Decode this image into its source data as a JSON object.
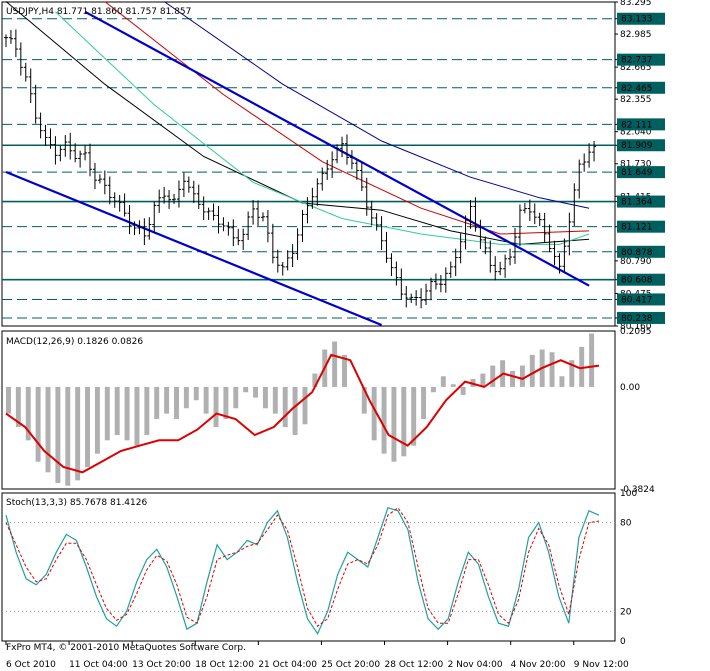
{
  "chart_data": {
    "type": "candlestick",
    "symbol_header": "USDJPY,H4  81.771 81.860 81.757 81.857",
    "watermark": "FxPro MT4, © 2001-2010 MetaQuotes Software Corp.",
    "x_ticks": [
      "6 Oct 2010",
      "11 Oct 04:00",
      "13 Oct 20:00",
      "18 Oct 12:00",
      "21 Oct 04:00",
      "25 Oct 20:00",
      "28 Oct 12:00",
      "2 Nov 04:00",
      "4 Nov 20:00",
      "9 Nov 12:00"
    ],
    "price_axis": {
      "ylim": [
        80.16,
        83.295
      ],
      "ticks": [
        "83.295",
        "83.133",
        "82.985",
        "82.737",
        "82.665",
        "82.465",
        "82.355",
        "82.111",
        "82.040",
        "81.909",
        "81.730",
        "81.649",
        "81.415",
        "81.364",
        "81.121",
        "80.790",
        "80.878",
        "80.608",
        "80.475",
        "80.417",
        "80.238",
        "80.160"
      ]
    },
    "close_path": [
      [
        0,
        82.95
      ],
      [
        2,
        82.85
      ],
      [
        4,
        82.55
      ],
      [
        6,
        82.2
      ],
      [
        8,
        81.95
      ],
      [
        10,
        81.85
      ],
      [
        12,
        81.9
      ],
      [
        14,
        81.82
      ],
      [
        16,
        81.8
      ],
      [
        18,
        81.6
      ],
      [
        20,
        81.5
      ],
      [
        22,
        81.38
      ],
      [
        24,
        81.25
      ],
      [
        26,
        81.1
      ],
      [
        28,
        81.05
      ],
      [
        30,
        81.3
      ],
      [
        32,
        81.45
      ],
      [
        34,
        81.35
      ],
      [
        36,
        81.6
      ],
      [
        38,
        81.4
      ],
      [
        40,
        81.3
      ],
      [
        42,
        81.2
      ],
      [
        44,
        81.15
      ],
      [
        46,
        81.0
      ],
      [
        48,
        81.05
      ],
      [
        50,
        81.3
      ],
      [
        52,
        81.2
      ],
      [
        54,
        80.85
      ],
      [
        56,
        80.7
      ],
      [
        58,
        80.9
      ],
      [
        60,
        81.2
      ],
      [
        62,
        81.45
      ],
      [
        64,
        81.6
      ],
      [
        66,
        81.8
      ],
      [
        68,
        81.9
      ],
      [
        70,
        81.75
      ],
      [
        72,
        81.5
      ],
      [
        74,
        81.2
      ],
      [
        76,
        81.0
      ],
      [
        78,
        80.7
      ],
      [
        80,
        80.5
      ],
      [
        82,
        80.4
      ],
      [
        84,
        80.45
      ],
      [
        86,
        80.55
      ],
      [
        88,
        80.6
      ],
      [
        90,
        80.7
      ],
      [
        92,
        81.0
      ],
      [
        94,
        81.3
      ],
      [
        96,
        81.0
      ],
      [
        98,
        80.75
      ],
      [
        100,
        80.7
      ],
      [
        102,
        80.85
      ],
      [
        104,
        81.25
      ],
      [
        106,
        81.3
      ],
      [
        108,
        81.15
      ],
      [
        110,
        80.95
      ],
      [
        112,
        80.7
      ],
      [
        114,
        81.2
      ],
      [
        116,
        81.7
      ],
      [
        118,
        81.86
      ]
    ],
    "horizontal_levels": [
      {
        "value": "83.133",
        "solid": false
      },
      {
        "value": "82.737",
        "solid": false
      },
      {
        "value": "82.465",
        "solid": false
      },
      {
        "value": "82.111",
        "solid": false
      },
      {
        "value": "81.909",
        "solid": true
      },
      {
        "value": "81.649",
        "solid": false
      },
      {
        "value": "81.364",
        "solid": true
      },
      {
        "value": "81.121",
        "solid": false
      },
      {
        "value": "80.878",
        "solid": false
      },
      {
        "value": "80.608",
        "solid": true
      },
      {
        "value": "80.417",
        "solid": false
      },
      {
        "value": "80.238",
        "solid": false
      }
    ],
    "channel_lines": [
      {
        "from": [
          16,
          83.2
        ],
        "to": [
          118,
          80.55
        ]
      },
      {
        "from": [
          0,
          81.65
        ],
        "to": [
          76,
          80.17
        ]
      }
    ],
    "moving_averages": [
      {
        "color": "#000000",
        "points": [
          [
            0,
            83.3
          ],
          [
            20,
            82.5
          ],
          [
            40,
            81.8
          ],
          [
            60,
            81.35
          ],
          [
            76,
            81.28
          ],
          [
            90,
            81.08
          ],
          [
            104,
            80.95
          ],
          [
            118,
            81.0
          ]
        ]
      },
      {
        "color": "#33cc99",
        "points": [
          [
            10,
            83.2
          ],
          [
            30,
            82.3
          ],
          [
            50,
            81.55
          ],
          [
            68,
            81.2
          ],
          [
            84,
            81.05
          ],
          [
            100,
            80.95
          ],
          [
            112,
            80.95
          ],
          [
            118,
            81.05
          ]
        ]
      },
      {
        "color": "#cc0000",
        "points": [
          [
            20,
            83.3
          ],
          [
            44,
            82.4
          ],
          [
            64,
            81.75
          ],
          [
            84,
            81.3
          ],
          [
            100,
            81.05
          ],
          [
            118,
            81.08
          ]
        ]
      },
      {
        "color": "#000099",
        "points": [
          [
            32,
            83.3
          ],
          [
            56,
            82.5
          ],
          [
            76,
            81.95
          ],
          [
            94,
            81.6
          ],
          [
            108,
            81.4
          ],
          [
            118,
            81.3
          ]
        ]
      }
    ],
    "macd": {
      "label": "MACD(12,26,9) 0.1826 0.0826",
      "ylim": [
        -0.3824,
        0.2095
      ],
      "ticks": [
        "0.2095",
        "0.00",
        "-0.3824"
      ],
      "histogram": [
        -0.1,
        -0.15,
        -0.2,
        -0.28,
        -0.32,
        -0.36,
        -0.37,
        -0.35,
        -0.3,
        -0.25,
        -0.2,
        -0.18,
        -0.2,
        -0.22,
        -0.18,
        -0.12,
        -0.1,
        -0.12,
        -0.08,
        -0.05,
        -0.1,
        -0.15,
        -0.12,
        -0.08,
        -0.02,
        -0.04,
        -0.08,
        -0.1,
        -0.15,
        -0.18,
        -0.14,
        0.05,
        0.14,
        0.17,
        0.12,
        0.0,
        -0.1,
        -0.2,
        -0.25,
        -0.28,
        -0.26,
        -0.22,
        -0.12,
        -0.02,
        0.04,
        0.01,
        -0.03,
        0.03,
        0.05,
        0.08,
        0.1,
        0.06,
        0.08,
        0.12,
        0.14,
        0.13,
        0.04,
        0.1,
        0.15,
        0.2
      ],
      "signal": [
        -0.1,
        -0.15,
        -0.24,
        -0.3,
        -0.32,
        -0.28,
        -0.24,
        -0.22,
        -0.2,
        -0.2,
        -0.16,
        -0.1,
        -0.12,
        -0.18,
        -0.15,
        -0.08,
        -0.02,
        0.12,
        0.1,
        -0.05,
        -0.18,
        -0.22,
        -0.15,
        -0.05,
        0.02,
        0.0,
        0.05,
        0.03,
        0.07,
        0.1,
        0.07,
        0.08
      ]
    },
    "stoch": {
      "label": "Stoch(13,3,3) 85.7678 81.4126",
      "ylim": [
        0,
        100
      ],
      "ticks": [
        "100",
        "80",
        "20",
        "0"
      ],
      "main": [
        85,
        60,
        42,
        38,
        45,
        60,
        72,
        68,
        50,
        30,
        15,
        10,
        20,
        40,
        55,
        62,
        50,
        30,
        8,
        12,
        40,
        65,
        55,
        60,
        68,
        65,
        80,
        88,
        70,
        40,
        15,
        5,
        20,
        45,
        60,
        55,
        50,
        70,
        90,
        88,
        75,
        40,
        15,
        8,
        15,
        40,
        60,
        52,
        30,
        12,
        10,
        35,
        70,
        80,
        60,
        30,
        12,
        70,
        88,
        85
      ],
      "signal": [
        80,
        65,
        50,
        40,
        42,
        55,
        66,
        66,
        55,
        38,
        22,
        14,
        18,
        32,
        48,
        58,
        54,
        38,
        16,
        12,
        30,
        55,
        58,
        60,
        64,
        66,
        75,
        85,
        75,
        50,
        22,
        10,
        15,
        35,
        52,
        55,
        52,
        65,
        85,
        90,
        80,
        50,
        22,
        12,
        12,
        32,
        55,
        55,
        38,
        18,
        12,
        28,
        60,
        76,
        65,
        38,
        18,
        55,
        80,
        81
      ]
    }
  }
}
